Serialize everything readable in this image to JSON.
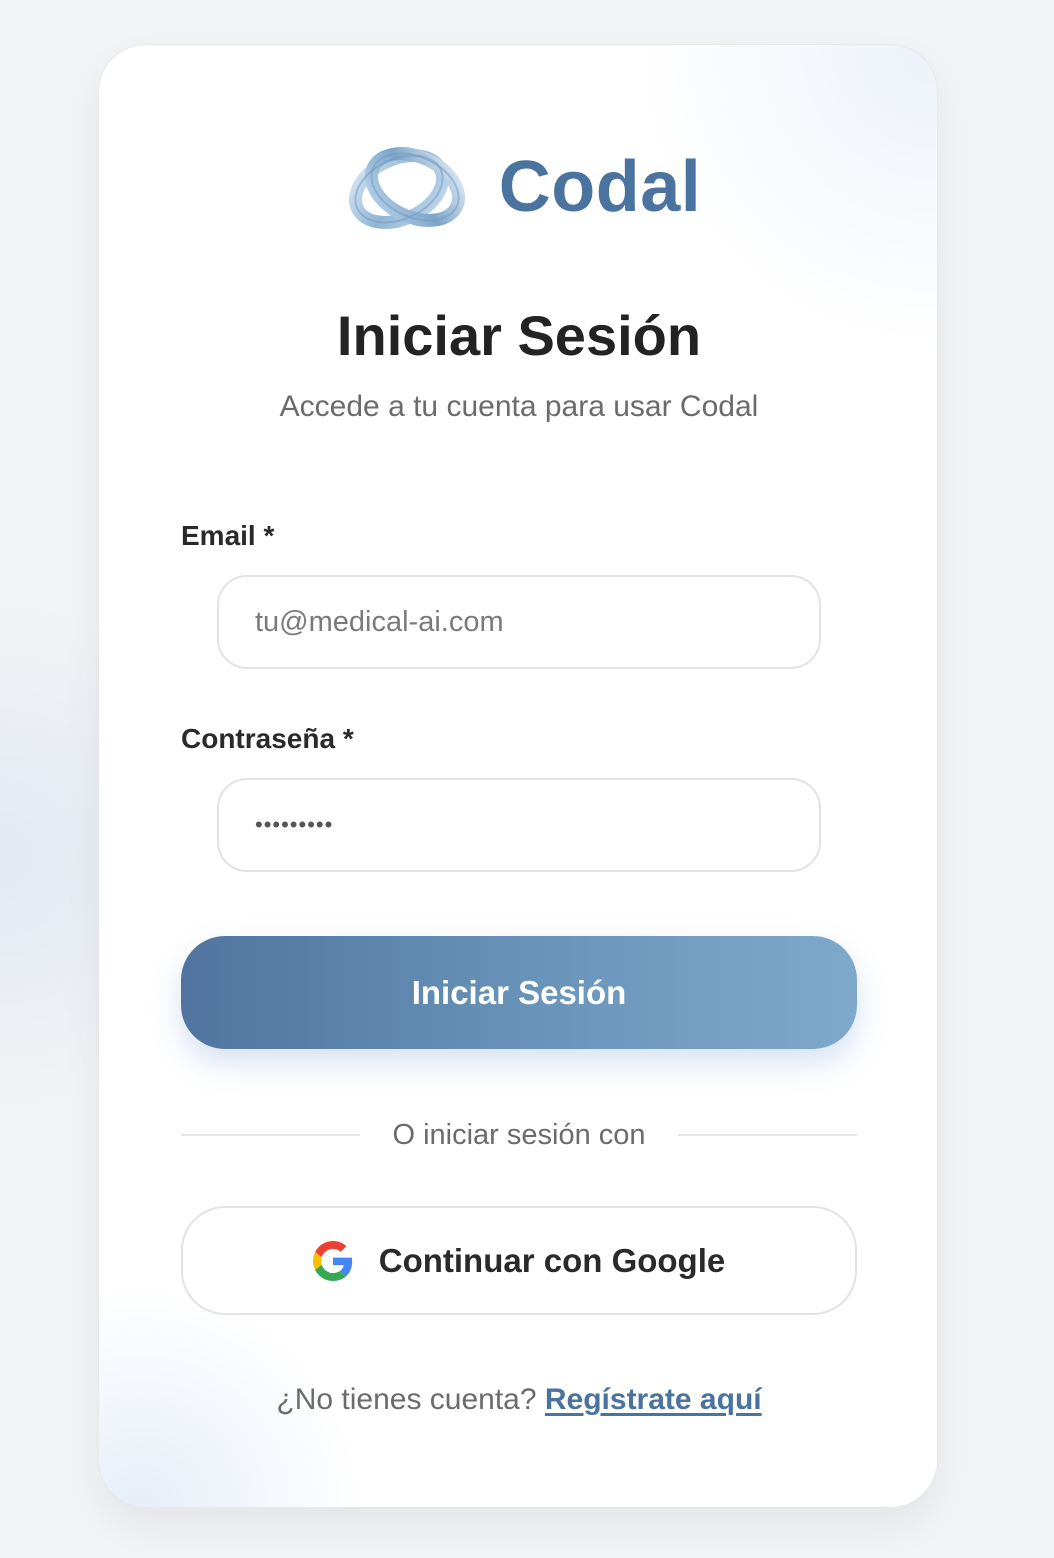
{
  "brand": {
    "name": "Codal",
    "logo_icon": "interlocked-rings-logo-icon",
    "color": "#4a739f"
  },
  "header": {
    "title": "Iniciar Sesión",
    "subtitle": "Accede a tu cuenta para usar Codal"
  },
  "form": {
    "email": {
      "label": "Email *",
      "placeholder": "tu@medical-ai.com",
      "value": ""
    },
    "password": {
      "label": "Contraseña *",
      "value": "•••••••••"
    },
    "submit_label": "Iniciar Sesión"
  },
  "divider": {
    "text": "O iniciar sesión con"
  },
  "google": {
    "icon": "google-icon",
    "label": "Continuar con Google"
  },
  "footer": {
    "prompt": "¿No tienes cuenta?",
    "link": "Regístrate aquí"
  },
  "colors": {
    "primary": "#4a739f",
    "button_gradient_start": "#50749f",
    "button_gradient_end": "#7fa9cb",
    "text_dark": "#232323",
    "text_muted": "#6b6b6b"
  }
}
